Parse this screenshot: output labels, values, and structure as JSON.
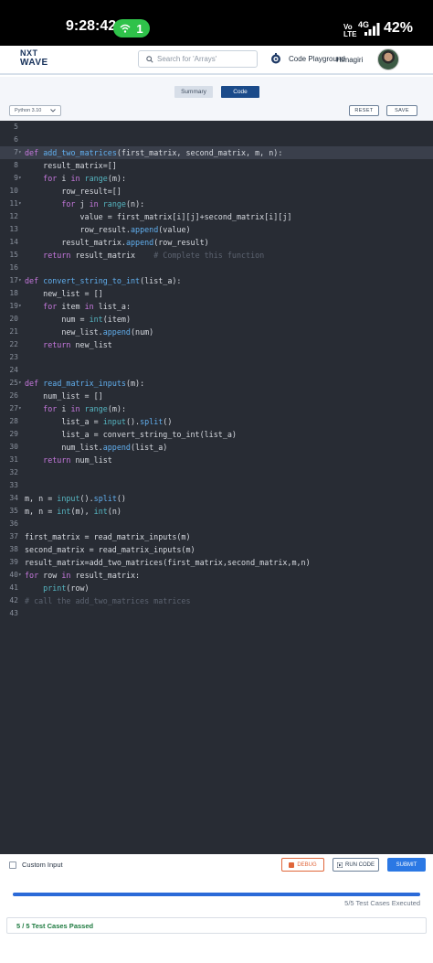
{
  "status_bar": {
    "time": "9:28:42",
    "hotspot_count": "1",
    "network_label_top": "Vo",
    "network_label_bottom": "LTE",
    "network_generation": "4G",
    "battery": "42%"
  },
  "header": {
    "logo_line1": "NXT",
    "logo_line2": "WAVE",
    "search_placeholder": "Search for 'Arrays'",
    "code_playground": "Code Playground",
    "username": "Himagiri"
  },
  "toolbar": {
    "tab_summary": "Summary",
    "tab_code": "Code",
    "language": "Python 3.10",
    "reset": "RESET",
    "save": "SAVE"
  },
  "editor": {
    "active_line": 7,
    "lines": [
      {
        "num": "5",
        "fold": "",
        "html": ""
      },
      {
        "num": "6",
        "fold": "",
        "html": ""
      },
      {
        "num": "7",
        "fold": "▾",
        "html": "<span class=\"kw\">def</span> <span class=\"fn\">add_two_matrices</span>(first_matrix, second_matrix, m, n):"
      },
      {
        "num": "8",
        "fold": "",
        "html": "    result_matrix=[]"
      },
      {
        "num": "9",
        "fold": "▾",
        "html": "    <span class=\"kw\">for</span> i <span class=\"kw\">in</span> <span class=\"bi\">range</span>(m):"
      },
      {
        "num": "10",
        "fold": "",
        "html": "        row_result=[]"
      },
      {
        "num": "11",
        "fold": "▾",
        "html": "        <span class=\"kw\">for</span> j <span class=\"kw\">in</span> <span class=\"bi\">range</span>(n):"
      },
      {
        "num": "12",
        "fold": "",
        "html": "            value = first_matrix[i][j]+second_matrix[i][j]"
      },
      {
        "num": "13",
        "fold": "",
        "html": "            row_result.<span class=\"fn\">append</span>(value)"
      },
      {
        "num": "14",
        "fold": "",
        "html": "        result_matrix.<span class=\"fn\">append</span>(row_result)"
      },
      {
        "num": "15",
        "fold": "",
        "html": "    <span class=\"kw\">return</span> result_matrix    <span class=\"cm\"># Complete this function</span>"
      },
      {
        "num": "16",
        "fold": "",
        "html": ""
      },
      {
        "num": "17",
        "fold": "▾",
        "html": "<span class=\"kw\">def</span> <span class=\"fn\">convert_string_to_int</span>(list_a):"
      },
      {
        "num": "18",
        "fold": "",
        "html": "    new_list = []"
      },
      {
        "num": "19",
        "fold": "▾",
        "html": "    <span class=\"kw\">for</span> item <span class=\"kw\">in</span> list_a:"
      },
      {
        "num": "20",
        "fold": "",
        "html": "        num = <span class=\"bi\">int</span>(item)"
      },
      {
        "num": "21",
        "fold": "",
        "html": "        new_list.<span class=\"fn\">append</span>(num)"
      },
      {
        "num": "22",
        "fold": "",
        "html": "    <span class=\"kw\">return</span> new_list"
      },
      {
        "num": "23",
        "fold": "",
        "html": ""
      },
      {
        "num": "24",
        "fold": "",
        "html": ""
      },
      {
        "num": "25",
        "fold": "▾",
        "html": "<span class=\"kw\">def</span> <span class=\"fn\">read_matrix_inputs</span>(m):"
      },
      {
        "num": "26",
        "fold": "",
        "html": "    num_list = []"
      },
      {
        "num": "27",
        "fold": "▾",
        "html": "    <span class=\"kw\">for</span> i <span class=\"kw\">in</span> <span class=\"bi\">range</span>(m):"
      },
      {
        "num": "28",
        "fold": "",
        "html": "        list_a = <span class=\"bi\">input</span>().<span class=\"fn\">split</span>()"
      },
      {
        "num": "29",
        "fold": "",
        "html": "        list_a = convert_string_to_int(list_a)"
      },
      {
        "num": "30",
        "fold": "",
        "html": "        num_list.<span class=\"fn\">append</span>(list_a)"
      },
      {
        "num": "31",
        "fold": "",
        "html": "    <span class=\"kw\">return</span> num_list"
      },
      {
        "num": "32",
        "fold": "",
        "html": ""
      },
      {
        "num": "33",
        "fold": "",
        "html": ""
      },
      {
        "num": "34",
        "fold": "",
        "html": "m, n = <span class=\"bi\">input</span>().<span class=\"fn\">split</span>()"
      },
      {
        "num": "35",
        "fold": "",
        "html": "m, n = <span class=\"bi\">int</span>(m), <span class=\"bi\">int</span>(n)"
      },
      {
        "num": "36",
        "fold": "",
        "html": ""
      },
      {
        "num": "37",
        "fold": "",
        "html": "first_matrix = read_matrix_inputs(m)"
      },
      {
        "num": "38",
        "fold": "",
        "html": "second_matrix = read_matrix_inputs(m)"
      },
      {
        "num": "39",
        "fold": "",
        "html": "result_matrix=add_two_matrices(first_matrix,second_matrix,m,n)"
      },
      {
        "num": "40",
        "fold": "▾",
        "html": "<span class=\"kw\">for</span> row <span class=\"kw\">in</span> result_matrix:"
      },
      {
        "num": "41",
        "fold": "",
        "html": "    <span class=\"bi\">print</span>(row)"
      },
      {
        "num": "42",
        "fold": "",
        "html": "<span class=\"cm\"># call the add_two_matrices matrices</span>"
      },
      {
        "num": "43",
        "fold": "",
        "html": ""
      }
    ]
  },
  "bottom": {
    "custom_input": "Custom Input",
    "debug": "DEBUG",
    "run_code": "RUN CODE",
    "submit": "SUBMIT",
    "progress": 1.0,
    "executed": "5/5 Test Cases Executed",
    "result": "5 / 5 Test Cases Passed"
  },
  "colors": {
    "accent": "#2b78e4",
    "editor_bg": "#282c34",
    "pass_green": "#1d7a3f",
    "debug_orange": "#e0663a"
  }
}
